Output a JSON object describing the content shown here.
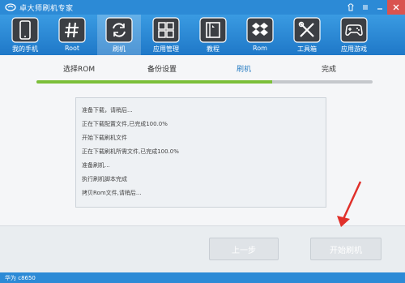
{
  "app": {
    "title": "卓大师刷机专家"
  },
  "toolbar": {
    "items": [
      {
        "label": "我的手机",
        "icon": "phone-icon"
      },
      {
        "label": "Root",
        "icon": "hash-icon"
      },
      {
        "label": "刷机",
        "icon": "refresh-icon"
      },
      {
        "label": "应用管理",
        "icon": "grid-icon"
      },
      {
        "label": "教程",
        "icon": "book-icon"
      },
      {
        "label": "Rom",
        "icon": "dropbox-icon"
      },
      {
        "label": "工具箱",
        "icon": "tools-icon"
      },
      {
        "label": "应用游戏",
        "icon": "gamepad-icon"
      }
    ],
    "active_index": 2
  },
  "steps": {
    "labels": [
      "选择ROM",
      "备份设置",
      "刷机",
      "完成"
    ],
    "current_index": 2,
    "progress_fraction": 0.7
  },
  "log": {
    "lines": [
      "准备下载，请稍后...",
      "正在下载配置文件,已完成100.0%",
      "开始下载刷机文件",
      "正在下载刷机所需文件,已完成100.0%",
      "准备刷机...",
      "执行刷机脚本完成",
      "拷贝Rom文件,请稍后..."
    ]
  },
  "buttons": {
    "prev": "上一步",
    "start": "开始刷机"
  },
  "status": {
    "device": "华为 c8650"
  },
  "colors": {
    "primary": "#2c8ad6",
    "accent_green": "#7cbf3a",
    "arrow_red": "#e0302a"
  }
}
